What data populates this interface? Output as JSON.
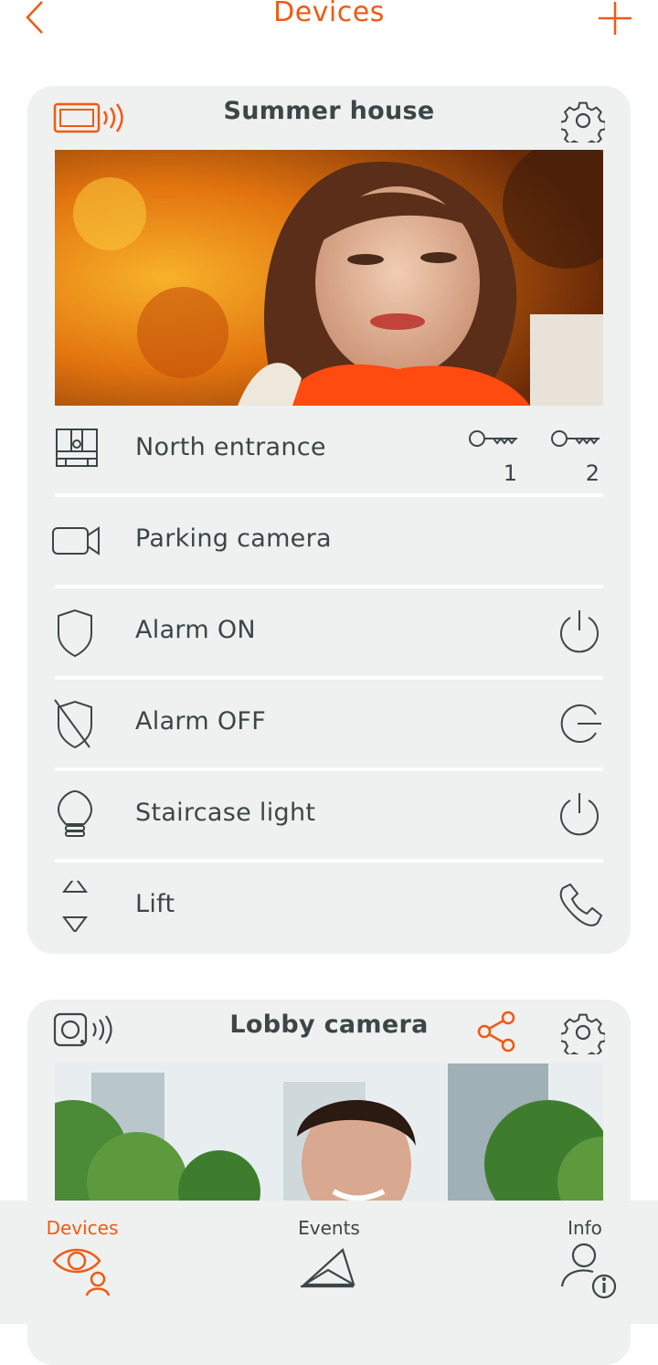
{
  "header": {
    "title": "Devices"
  },
  "card1": {
    "title": "Summer house",
    "rows": [
      {
        "label": "North entrance",
        "key1": "1",
        "key2": "2"
      },
      {
        "label": "Parking camera"
      },
      {
        "label": "Alarm ON"
      },
      {
        "label": "Alarm OFF"
      },
      {
        "label": "Staircase light"
      },
      {
        "label": "Lift"
      }
    ]
  },
  "card2": {
    "title": "Lobby camera"
  },
  "nav": {
    "devices": "Devices",
    "events": "Events",
    "info": "Info"
  },
  "colors": {
    "accent": "#f05a14",
    "card": "#eef1f0",
    "text": "#3c4646"
  }
}
